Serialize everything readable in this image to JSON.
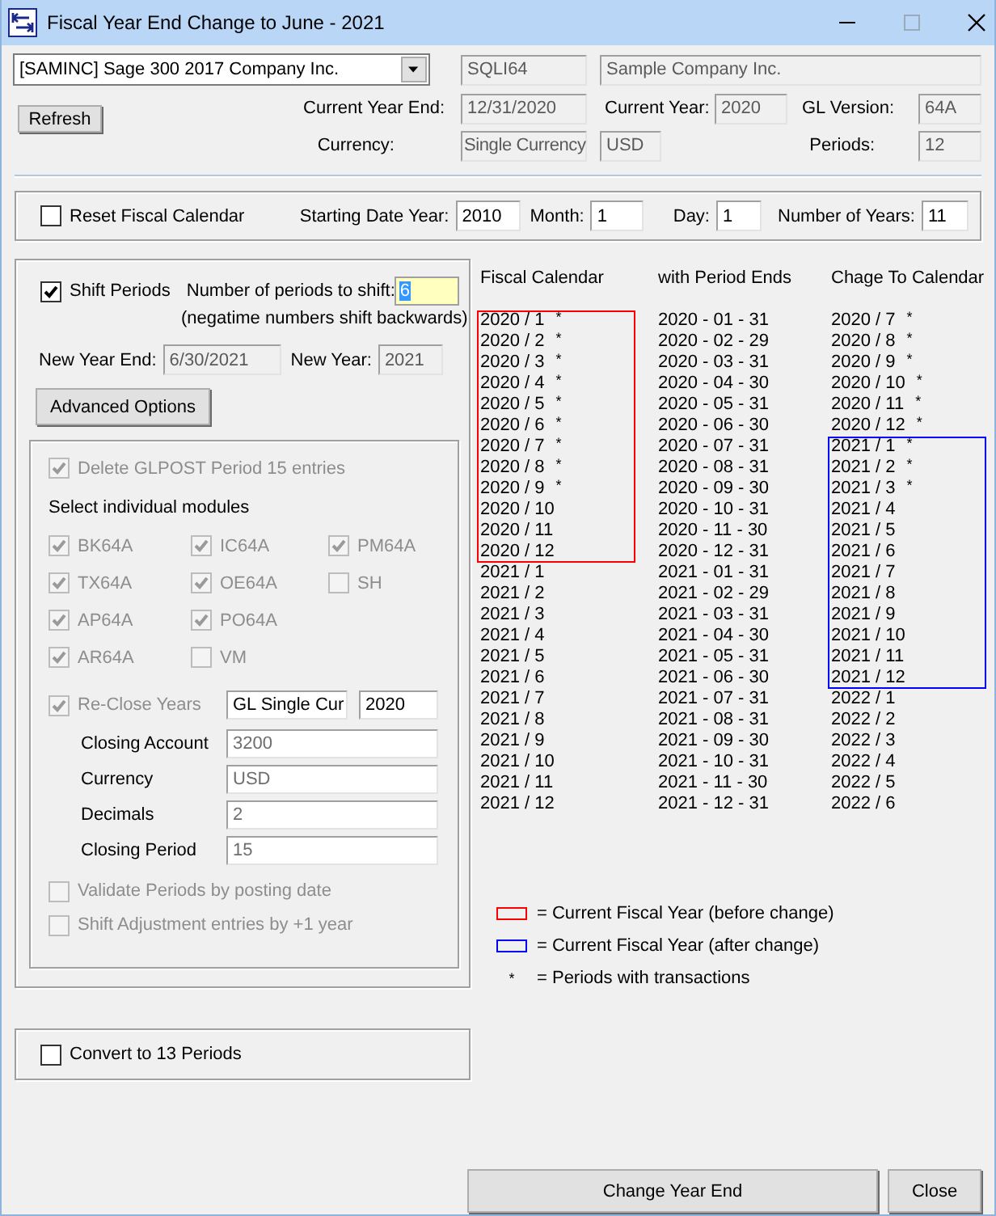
{
  "window": {
    "title": "Fiscal Year End Change to June - 2021"
  },
  "company": {
    "selector": "[SAMINC] Sage 300 2017 Company Inc.",
    "database": "SQLI64",
    "name": "Sample Company Inc."
  },
  "refresh_button": "Refresh",
  "current_year_end": {
    "label": "Current Year End:",
    "value": "12/31/2020"
  },
  "current_year": {
    "label": "Current Year:",
    "value": "2020"
  },
  "gl_version": {
    "label": "GL Version:",
    "value": "64A"
  },
  "currency": {
    "label": "Currency:",
    "value": "Single Currency",
    "code": "USD"
  },
  "periods": {
    "label": "Periods:",
    "value": "12"
  },
  "reset": {
    "label": "Reset Fiscal Calendar",
    "checked": false,
    "fields": [
      {
        "label": "Starting Date Year:",
        "value": "2010"
      },
      {
        "label": "Month:",
        "value": "1"
      },
      {
        "label": "Day:",
        "value": "1"
      },
      {
        "label": "Number of Years:",
        "value": "11"
      }
    ]
  },
  "shift": {
    "label": "Shift Periods",
    "checked": true,
    "count_label": "Number of periods to shift:",
    "count": "6",
    "count_selected": true,
    "hint": "(negatime numbers shift backwards)",
    "new_year_end": {
      "label": "New Year End:",
      "value": "6/30/2021"
    },
    "new_year": {
      "label": "New Year:",
      "value": "2021"
    },
    "advanced_button": "Advanced Options"
  },
  "advanced": {
    "disabled": true,
    "delete_glpost": {
      "label": "Delete GLPOST Period 15 entries",
      "checked": true
    },
    "modules_label": "Select individual modules",
    "module_columns": [
      {
        "items": [
          {
            "label": "BK64A",
            "checked": true
          },
          {
            "label": "TX64A",
            "checked": true
          },
          {
            "label": "AP64A",
            "checked": true
          },
          {
            "label": "AR64A",
            "checked": true
          }
        ]
      },
      {
        "items": [
          {
            "label": "IC64A",
            "checked": true
          },
          {
            "label": "OE64A",
            "checked": true
          },
          {
            "label": "PO64A",
            "checked": true
          },
          {
            "label": "VM",
            "checked": false
          }
        ]
      },
      {
        "items": [
          {
            "label": "PM64A",
            "checked": true
          },
          {
            "label": "SH",
            "checked": false
          }
        ]
      }
    ],
    "reclose": {
      "label": "Re-Close Years",
      "checked": true,
      "ledger": "GL Single Cur",
      "year": "2020"
    },
    "closing_fields": [
      {
        "label": "Closing Account",
        "value": "3200"
      },
      {
        "label": "Currency",
        "value": "USD"
      },
      {
        "label": "Decimals",
        "value": "2"
      },
      {
        "label": "Closing Period",
        "value": "15"
      }
    ],
    "options": [
      {
        "label": "Validate Periods by posting date",
        "checked": false
      },
      {
        "label": "Shift Adjustment entries by +1 year",
        "checked": false
      }
    ]
  },
  "convert": {
    "label": "Convert to 13 Periods",
    "checked": false
  },
  "calendar": {
    "columns": [
      {
        "header": "Fiscal Calendar",
        "color": "#ff0000",
        "entries": [
          {
            "text": "2020 / 1",
            "mark": "*",
            "current": true
          },
          {
            "text": "2020 / 2",
            "mark": "*",
            "current": true
          },
          {
            "text": "2020 / 3",
            "mark": "*",
            "current": true
          },
          {
            "text": "2020 / 4",
            "mark": "*",
            "current": true
          },
          {
            "text": "2020 / 5",
            "mark": "*",
            "current": true
          },
          {
            "text": "2020 / 6",
            "mark": "*",
            "current": true
          },
          {
            "text": "2020 / 7",
            "mark": "*",
            "current": true
          },
          {
            "text": "2020 / 8",
            "mark": "*",
            "current": true
          },
          {
            "text": "2020 / 9",
            "mark": "*",
            "current": true
          },
          {
            "text": "2020 / 10",
            "current": true
          },
          {
            "text": "2020 / 11",
            "current": true
          },
          {
            "text": "2020 / 12",
            "current": true
          },
          {
            "text": "2021 / 1",
            "current": false
          },
          {
            "text": "2021 / 2",
            "current": false
          },
          {
            "text": "2021 / 3",
            "current": false
          },
          {
            "text": "2021 / 4",
            "current": false
          },
          {
            "text": "2021 / 5",
            "current": false
          },
          {
            "text": "2021 / 6",
            "current": false
          },
          {
            "text": "2021 / 7",
            "current": false
          },
          {
            "text": "2021 / 8",
            "current": false
          },
          {
            "text": "2021 / 9",
            "current": false
          },
          {
            "text": "2021 / 10",
            "current": false
          },
          {
            "text": "2021 / 11",
            "current": false
          },
          {
            "text": "2021 / 12",
            "current": false
          }
        ]
      },
      {
        "header": "with Period Ends",
        "entries": [
          {
            "text": "2020 - 01 - 31"
          },
          {
            "text": "2020 - 02 - 29"
          },
          {
            "text": "2020 - 03 - 31"
          },
          {
            "text": "2020 - 04 - 30"
          },
          {
            "text": "2020 - 05 - 31"
          },
          {
            "text": "2020 - 06 - 30"
          },
          {
            "text": "2020 - 07 - 31"
          },
          {
            "text": "2020 - 08 - 31"
          },
          {
            "text": "2020 - 09 - 30"
          },
          {
            "text": "2020 - 10 - 31"
          },
          {
            "text": "2020 - 11 - 30"
          },
          {
            "text": "2020 - 12 - 31"
          },
          {
            "text": "2021 - 01 - 31"
          },
          {
            "text": "2021 - 02 - 29"
          },
          {
            "text": "2021 - 03 - 31"
          },
          {
            "text": "2021 - 04 - 30"
          },
          {
            "text": "2021 - 05 - 31"
          },
          {
            "text": "2021 - 06 - 30"
          },
          {
            "text": "2021 - 07 - 31"
          },
          {
            "text": "2021 - 08 - 31"
          },
          {
            "text": "2021 - 09 - 30"
          },
          {
            "text": "2021 - 10 - 31"
          },
          {
            "text": "2021 - 11 - 30"
          },
          {
            "text": "2021 - 12 - 31"
          }
        ]
      },
      {
        "header": "Chage To Calendar",
        "color": "#0000ff",
        "entries": [
          {
            "text": "2020 / 7",
            "mark": "*",
            "current": false
          },
          {
            "text": "2020 / 8",
            "mark": "*",
            "current": false
          },
          {
            "text": "2020 / 9",
            "mark": "*",
            "current": false
          },
          {
            "text": "2020 / 10",
            "mark": "*",
            "current": false
          },
          {
            "text": "2020 / 11",
            "mark": "*",
            "current": false
          },
          {
            "text": "2020 / 12",
            "mark": "*",
            "current": false
          },
          {
            "text": "2021 / 1",
            "mark": "*",
            "current": true
          },
          {
            "text": "2021 / 2",
            "mark": "*",
            "current": true
          },
          {
            "text": "2021 / 3",
            "mark": "*",
            "current": true
          },
          {
            "text": "2021 / 4",
            "current": true
          },
          {
            "text": "2021 / 5",
            "current": true
          },
          {
            "text": "2021 / 6",
            "current": true
          },
          {
            "text": "2021 / 7",
            "current": true
          },
          {
            "text": "2021 / 8",
            "current": true
          },
          {
            "text": "2021 / 9",
            "current": true
          },
          {
            "text": "2021 / 10",
            "current": true
          },
          {
            "text": "2021 / 11",
            "current": true
          },
          {
            "text": "2021 / 12",
            "current": true
          },
          {
            "text": "2022 / 1",
            "current": false
          },
          {
            "text": "2022 / 2",
            "current": false
          },
          {
            "text": "2022 / 3",
            "current": false
          },
          {
            "text": "2022 / 4",
            "current": false
          },
          {
            "text": "2022 / 5",
            "current": false
          },
          {
            "text": "2022 / 6",
            "current": false
          }
        ]
      }
    ]
  },
  "legend": [
    {
      "kind": "swatch",
      "color": "#ff0000",
      "text": "=  Current Fiscal Year (before change)"
    },
    {
      "kind": "swatch",
      "color": "#0000ff",
      "text": "=  Current Fiscal Year (after change)"
    },
    {
      "kind": "symbol",
      "symbol": "*",
      "text": "=  Periods with transactions"
    }
  ],
  "buttons": [
    {
      "label": "Change Year End"
    },
    {
      "label": "Close"
    }
  ]
}
